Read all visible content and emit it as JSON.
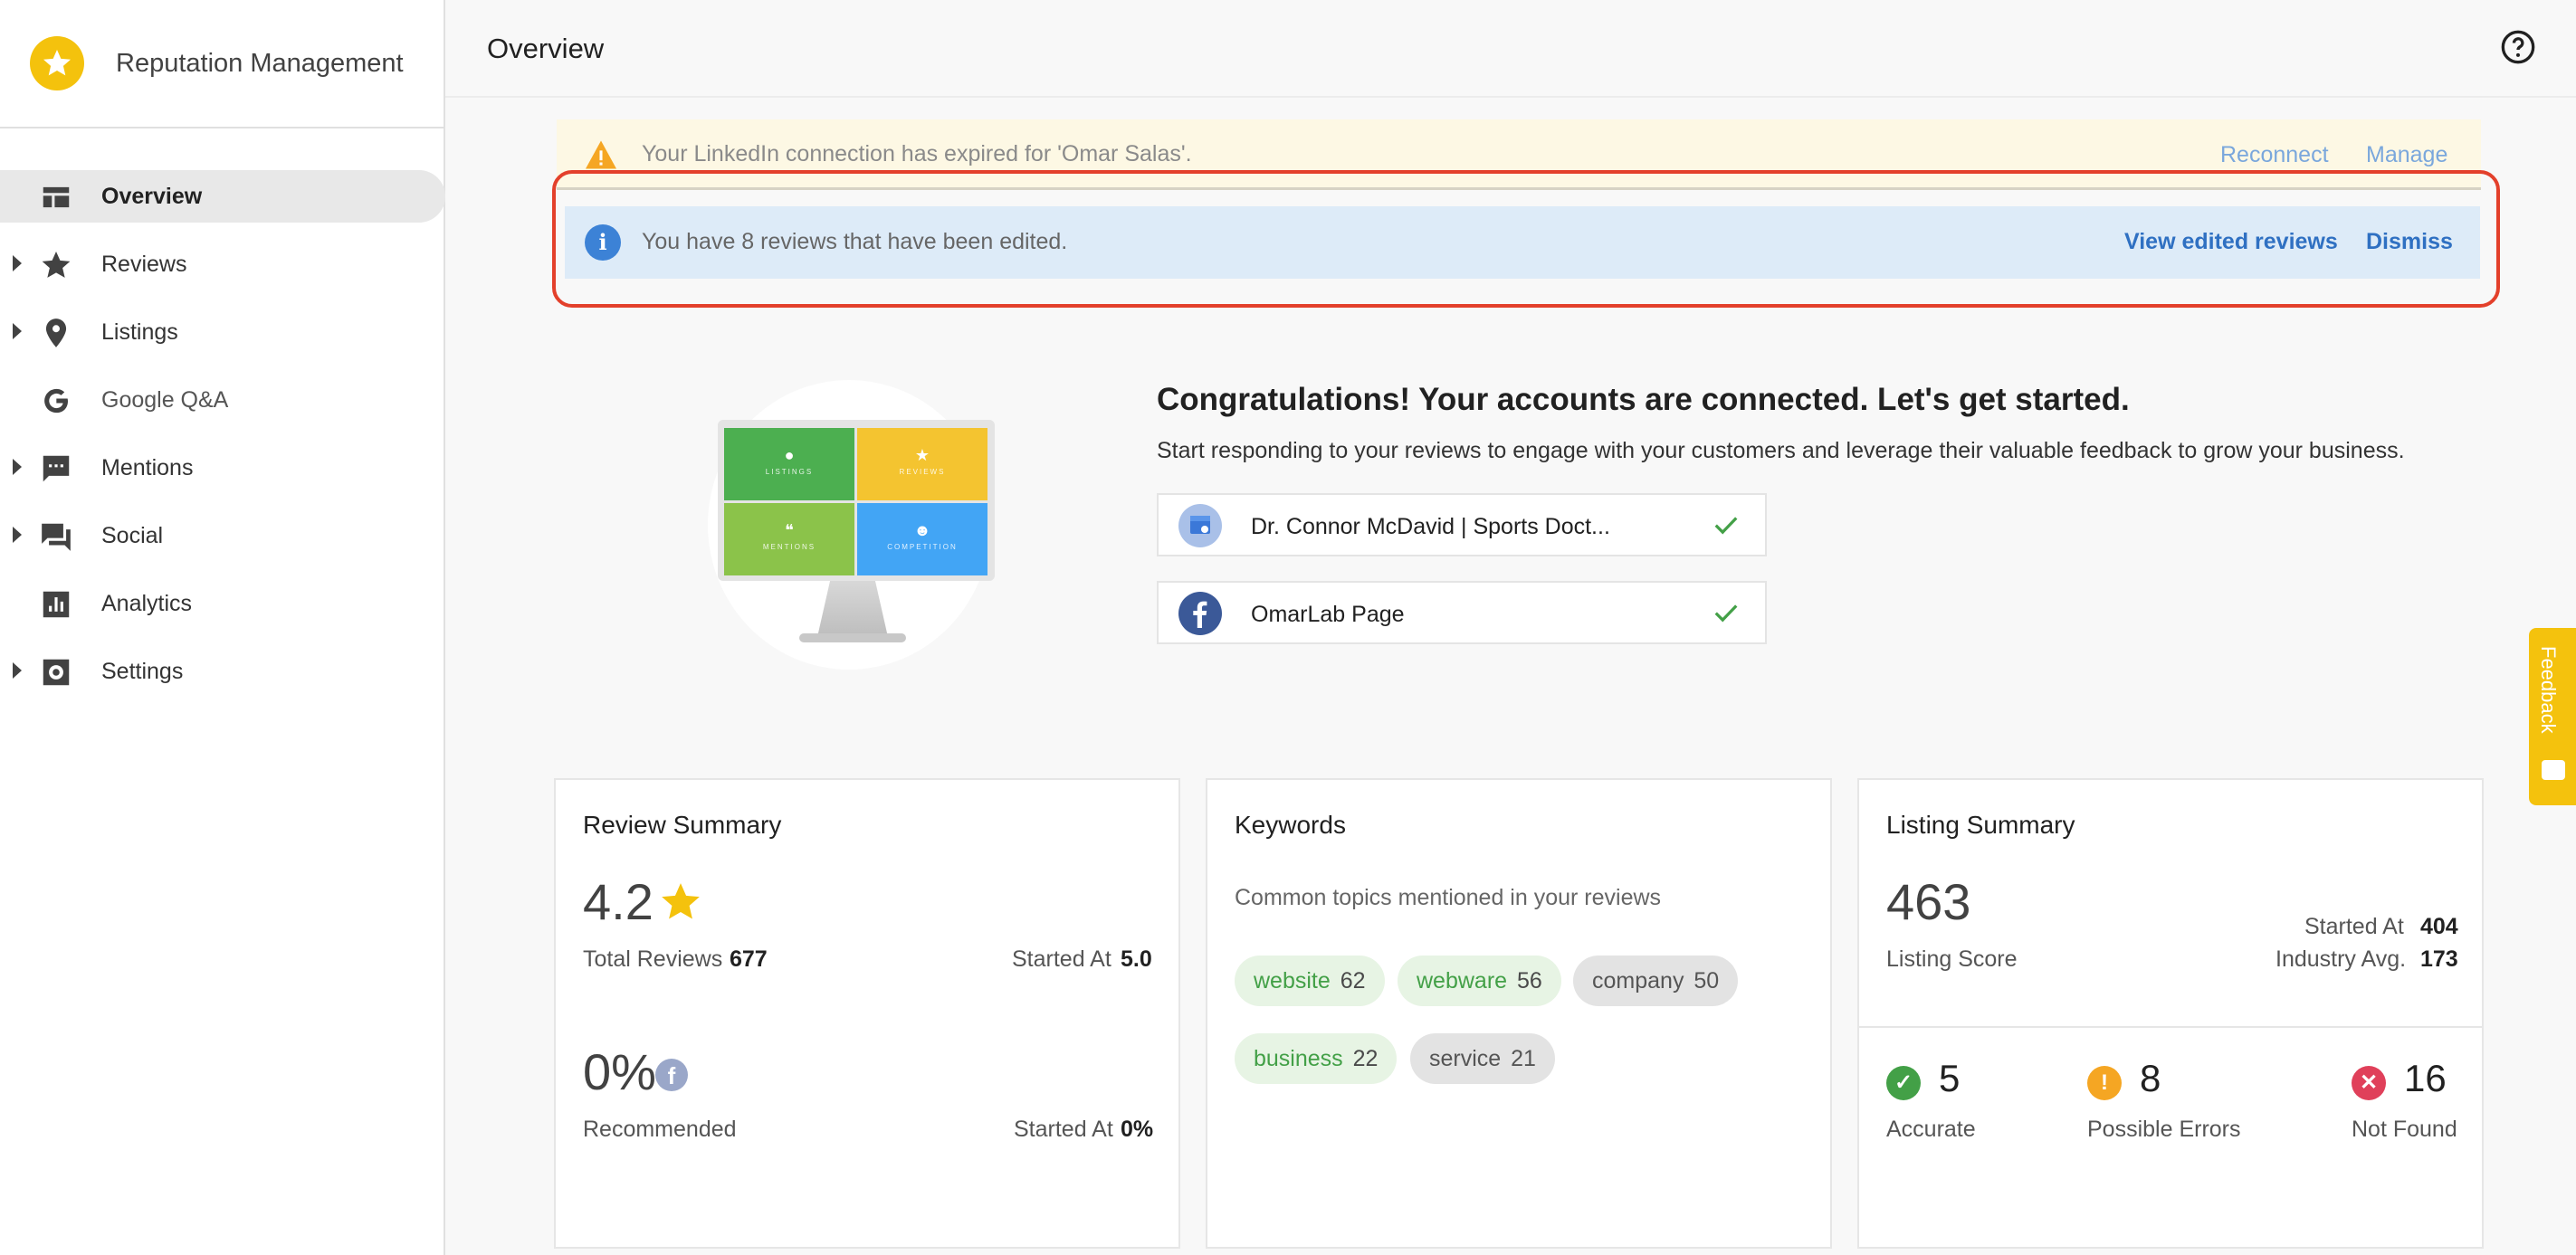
{
  "app": {
    "title": "Reputation Management",
    "brand_color": "#f4c20d"
  },
  "sidebar": {
    "items": [
      {
        "label": "Overview",
        "icon": "dashboard-icon",
        "active": true,
        "expandable": false
      },
      {
        "label": "Reviews",
        "icon": "star-icon",
        "active": false,
        "expandable": true
      },
      {
        "label": "Listings",
        "icon": "location-pin-icon",
        "active": false,
        "expandable": true
      },
      {
        "label": "Google Q&A",
        "icon": "google-icon",
        "active": false,
        "expandable": false
      },
      {
        "label": "Mentions",
        "icon": "comment-dots-icon",
        "active": false,
        "expandable": true
      },
      {
        "label": "Social",
        "icon": "forum-icon",
        "active": false,
        "expandable": true
      },
      {
        "label": "Analytics",
        "icon": "bar-chart-icon",
        "active": false,
        "expandable": false
      },
      {
        "label": "Settings",
        "icon": "gear-icon",
        "active": false,
        "expandable": true
      }
    ]
  },
  "header": {
    "title": "Overview",
    "help_icon": "help-circle-icon"
  },
  "alerts": {
    "warning": {
      "text": "Your LinkedIn connection has expired for 'Omar Salas'.",
      "reconnect": "Reconnect",
      "manage": "Manage",
      "icon": "warning-icon"
    },
    "info": {
      "text": "You have 8 reviews that have been edited.",
      "view": "View edited reviews",
      "dismiss": "Dismiss",
      "icon": "info-icon"
    }
  },
  "hero": {
    "title": "Congratulations! Your accounts are connected. Let's get started.",
    "subtitle": "Start responding to your reviews to engage with your customers and leverage their valuable feedback to grow your business.",
    "tiles": [
      {
        "label": "LISTINGS",
        "color": "#4caf50",
        "icon": "pin-icon"
      },
      {
        "label": "REVIEWS",
        "color": "#f4c430",
        "icon": "star-icon"
      },
      {
        "label": "MENTIONS",
        "color": "#8bc34a",
        "icon": "quote-icon"
      },
      {
        "label": "COMPETITION",
        "color": "#42a5f5",
        "icon": "person-icon"
      }
    ],
    "accounts": [
      {
        "name": "Dr. Connor McDavid | Sports Doct...",
        "icon": "google-my-business-icon"
      },
      {
        "name": "OmarLab Page",
        "icon": "facebook-icon"
      }
    ]
  },
  "review_summary": {
    "title": "Review Summary",
    "rating": "4.2",
    "total_label": "Total Reviews",
    "total_value": "677",
    "started_label": "Started At",
    "started_value": "5.0",
    "recommended_pct": "0%",
    "recommended_label": "Recommended",
    "started2_label": "Started At",
    "started2_value": "0%"
  },
  "keywords": {
    "title": "Keywords",
    "subtitle": "Common topics mentioned in your reviews",
    "chips": [
      {
        "word": "website",
        "count": "62",
        "tone": "green"
      },
      {
        "word": "webware",
        "count": "56",
        "tone": "green"
      },
      {
        "word": "company",
        "count": "50",
        "tone": "gray"
      },
      {
        "word": "business",
        "count": "22",
        "tone": "green"
      },
      {
        "word": "service",
        "count": "21",
        "tone": "gray"
      }
    ]
  },
  "listing_summary": {
    "title": "Listing Summary",
    "score": "463",
    "score_label": "Listing Score",
    "started_label": "Started At",
    "started_value": "404",
    "industry_label": "Industry Avg.",
    "industry_value": "173",
    "stats": [
      {
        "value": "5",
        "label": "Accurate",
        "color": "#43a047",
        "icon": "check-circle-icon"
      },
      {
        "value": "8",
        "label": "Possible Errors",
        "color": "#f5a623",
        "icon": "exclamation-circle-icon"
      },
      {
        "value": "16",
        "label": "Not Found",
        "color": "#e0405a",
        "icon": "x-circle-icon"
      }
    ]
  },
  "feedback": {
    "label": "Feedback"
  }
}
